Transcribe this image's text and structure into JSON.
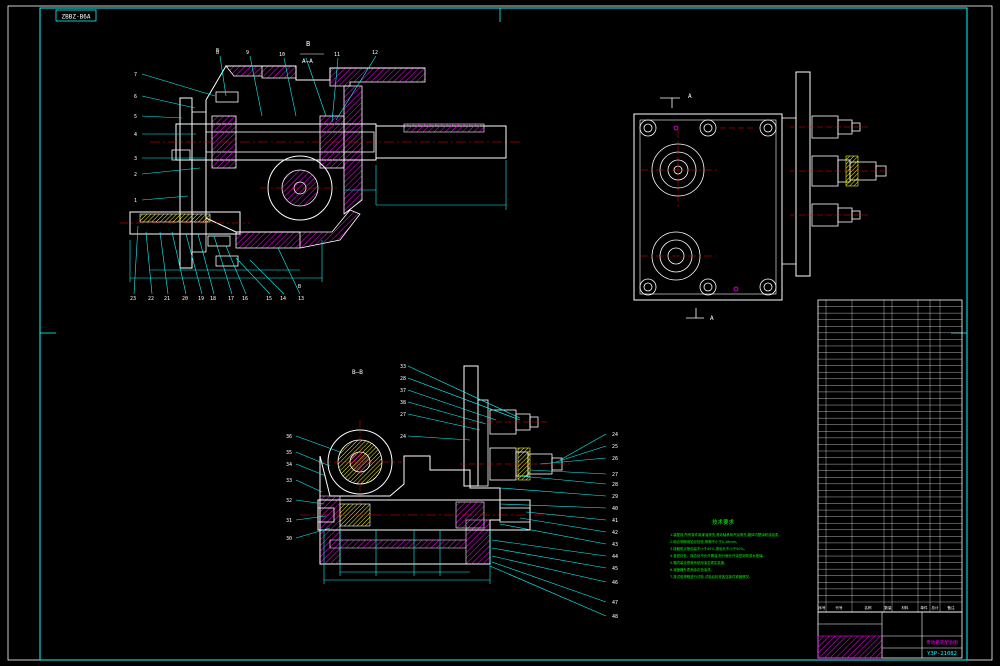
{
  "sheet": {
    "doc_code": "ZBBZ-B6A",
    "drawing_number": "Y3P-21082",
    "title_cn": "传动箱装配总图"
  },
  "views": {
    "section_top_cut": "B",
    "section_top_label": "A—A",
    "section_bottom_label": "B—B",
    "side_view_arrow": "A",
    "side_view_arrow_bottom": "A",
    "top_view_b_marks": [
      "B",
      "B"
    ]
  },
  "balloons": {
    "top_left": [
      "7",
      "6",
      "5",
      "4",
      "3",
      "2",
      "1"
    ],
    "top_top": [
      "8",
      "9",
      "10",
      "11",
      "12"
    ],
    "top_bottom": [
      "23",
      "22",
      "21",
      "20",
      "19",
      "18",
      "17",
      "16",
      "15",
      "14",
      "13"
    ],
    "bottom_left": [
      "36",
      "35",
      "34",
      "33",
      "32",
      "31",
      "30"
    ],
    "bottom_top": [
      "33",
      "28",
      "37",
      "38",
      "27",
      "24"
    ],
    "bottom_right": [
      "24",
      "25",
      "26",
      "27",
      "28",
      "29",
      "40",
      "41",
      "42",
      "43",
      "44",
      "45",
      "46",
      "47",
      "48"
    ]
  },
  "notes": {
    "heading": "技术要求",
    "lines": [
      "1.装配前,所有零件用煤油清洗,滚动轴承用汽油清洗,箱体内壁涂耐油油漆。",
      "2.啮合侧隙用铅丝检验,侧隙不小于0.16mm。",
      "3.接触斑点按齿高不小于40%,按齿长不小于50%。",
      "4.各密封处、接合处不允许漏油,剖分面允许涂密封胶或水玻璃。",
      "5.箱内装全损耗系统用油至规定高度。",
      "6.减速器外表面涂灰色油漆。",
      "7.按试验规程进行试验,试验后检查各连接件紧固情况。"
    ]
  },
  "parts_list": {
    "rows": 46,
    "header": [
      "序号",
      "代号",
      "名称",
      "数量",
      "材料",
      "单件",
      "总计",
      "备注"
    ]
  },
  "colors": {
    "background": "#000000",
    "border": "#00ffff",
    "outline": "#ffffff",
    "hatch": "#ff00ff",
    "dimension": "#00ffff",
    "leader": "#00ffff",
    "notes": "#00ff00",
    "table_text": "#00ff00",
    "highlight": "#ffff00",
    "title_block": "#ff00ff"
  }
}
